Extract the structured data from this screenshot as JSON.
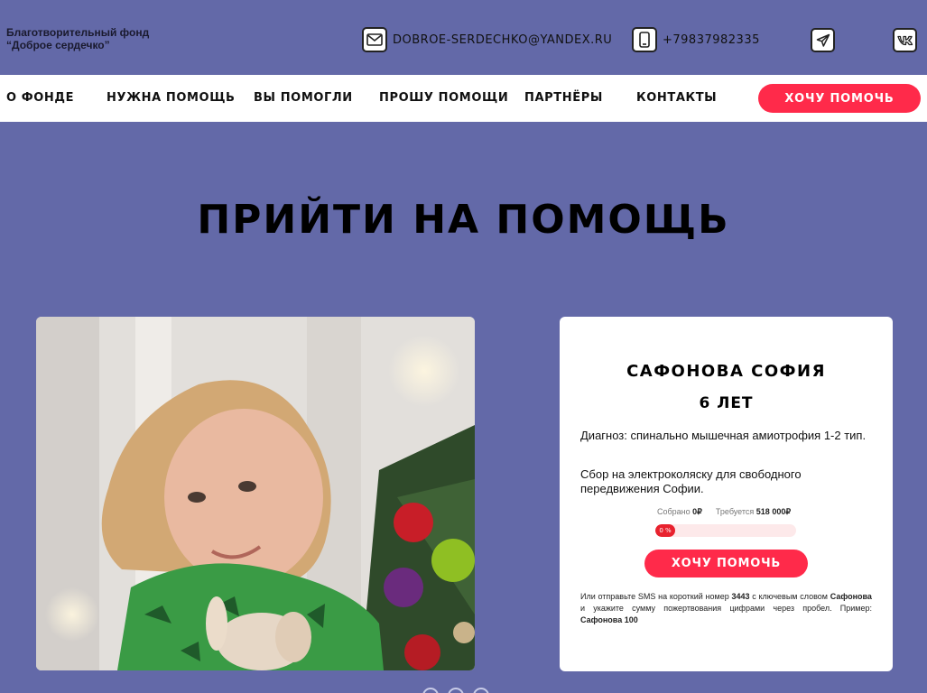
{
  "header": {
    "org_line1": "Благотворительный фонд",
    "org_line2": "“Доброе сердечко”",
    "email": "DOBROE-SERDECHKO@YANDEX.RU",
    "phone": "+79837982335"
  },
  "nav": {
    "items": [
      "О ФОНДЕ",
      "НУЖНА ПОМОЩЬ",
      "ВЫ ПОМОГЛИ",
      "ПРОШУ ПОМОЩИ",
      "ПАРТНЁРЫ",
      "КОНТАКТЫ"
    ],
    "cta": "ХОЧУ ПОМОЧЬ"
  },
  "main": {
    "title": "ПРИЙТИ НА ПОМОЩЬ"
  },
  "card": {
    "name": "САФОНОВА СОФИЯ",
    "age": "6 ЛЕТ",
    "diagnosis": "Диагноз: спинально мышечная амиотрофия 1-2 тип.",
    "purpose": "Сбор на электроколяску для свободного передвижения Софии.",
    "collected_label": "Собрано",
    "collected_value": "0₽",
    "required_label": "Требуется",
    "required_value": "518 000₽",
    "progress_fraction": 0,
    "progress_text": "0 %",
    "button": "ХОЧУ ПОМОЧЬ",
    "sms_part1": "Или отправьте SMS на короткий номер",
    "sms_number": "3443",
    "sms_part2": "с ключевым словом",
    "sms_keyword": "Сафонова",
    "sms_part3": "и укажите сумму пожертвования цифрами через пробел. Пример:",
    "sms_example": "Сафонова 100"
  },
  "colors": {
    "background": "#6369a8",
    "accent": "#ff2a4a",
    "progress": "#e8222e"
  },
  "icons": [
    "mail-icon",
    "phone-icon",
    "telegram-icon",
    "vk-icon"
  ]
}
